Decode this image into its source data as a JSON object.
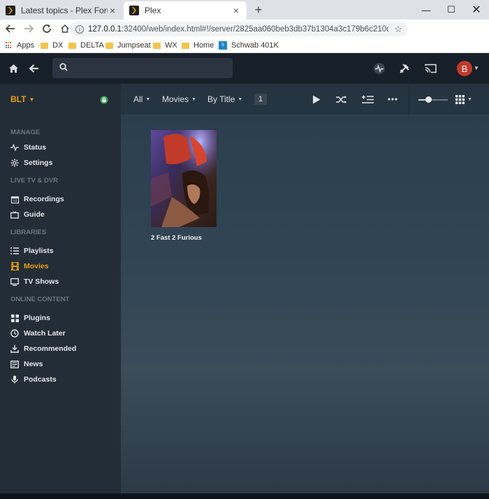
{
  "browser": {
    "tabs": [
      {
        "title": "Latest topics - Plex Forum",
        "active": false
      },
      {
        "title": "Plex",
        "active": true
      }
    ],
    "new_tab_label": "+",
    "url_host": "127.0.0.1",
    "url_rest": ":32400/web/index.html#!/server/2825aa060beb3db37b1304a3c179b6c210d5c508?k...",
    "bookmarks": [
      "Apps",
      "DX",
      "DELTA",
      "Jumpseat",
      "WX",
      "Home",
      "Schwab 401K"
    ]
  },
  "plex": {
    "search_placeholder": "",
    "user_initial": "B",
    "server_name": "BLT",
    "sidebar": {
      "manage_heading": "MANAGE",
      "manage": [
        "Status",
        "Settings"
      ],
      "livetv_heading": "LIVE TV & DVR",
      "livetv": [
        "Recordings",
        "Guide"
      ],
      "libraries_heading": "LIBRARIES",
      "libraries": [
        "Playlists",
        "Movies",
        "TV Shows"
      ],
      "online_heading": "ONLINE CONTENT",
      "online": [
        "Plugins",
        "Watch Later",
        "Recommended",
        "News",
        "Podcasts"
      ],
      "active_item": "Movies"
    },
    "library_bar": {
      "filter_all": "All",
      "filter_type": "Movies",
      "sort": "By Title",
      "count": "1",
      "poster_size_fraction": 0.35
    },
    "items": [
      {
        "title": "2 Fast 2 Furious"
      }
    ]
  },
  "colors": {
    "accent": "#e5a00d",
    "sidebar_bg": "#232d38",
    "topbar_bg": "#172029",
    "avatar": "#c0392b"
  }
}
